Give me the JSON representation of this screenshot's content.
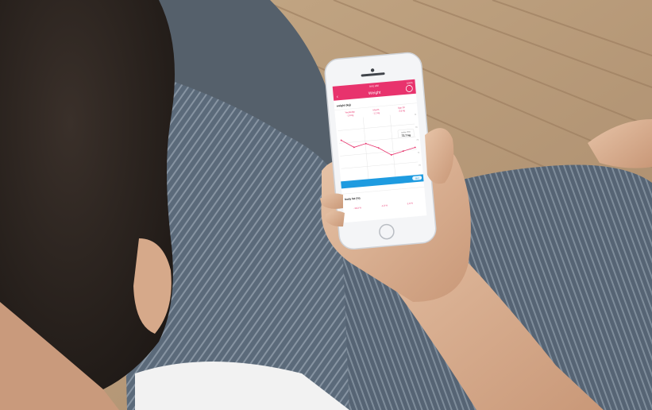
{
  "photo": {
    "subject": "person holding a smartphone showing a weight tracking app",
    "colors": {
      "accent": "#e8336d",
      "chart_line": "#e8336d",
      "blue_bar": "#1e9be0",
      "floor": "#b89a7a",
      "pants": "#5a6877"
    }
  },
  "app": {
    "status_time": "9:41 AM",
    "status_battery": "100%",
    "title": "Weight",
    "section_weight": "weight (kg)",
    "col1_label": "Yesterday",
    "col1_value": "-1.8 kg",
    "col2_label": "Month",
    "col2_value": "-1.2 kg",
    "col3_label": "Ago 30",
    "col3_value": "-3.8 kg",
    "y_ticks": [
      "74",
      "73",
      "72",
      "71",
      "70"
    ],
    "tooltip_date": "today, 20m",
    "tooltip_value": "72.7 kg",
    "bar_badge": "BMI",
    "section_body": "body fat (%)",
    "body_values": [
      "-18.8 %",
      "-1.8 %",
      "-1.9 %"
    ]
  },
  "chart_data": {
    "type": "line",
    "y": [
      72.4,
      72.1,
      72.2,
      72.0,
      71.7,
      71.8,
      71.9
    ]
  }
}
